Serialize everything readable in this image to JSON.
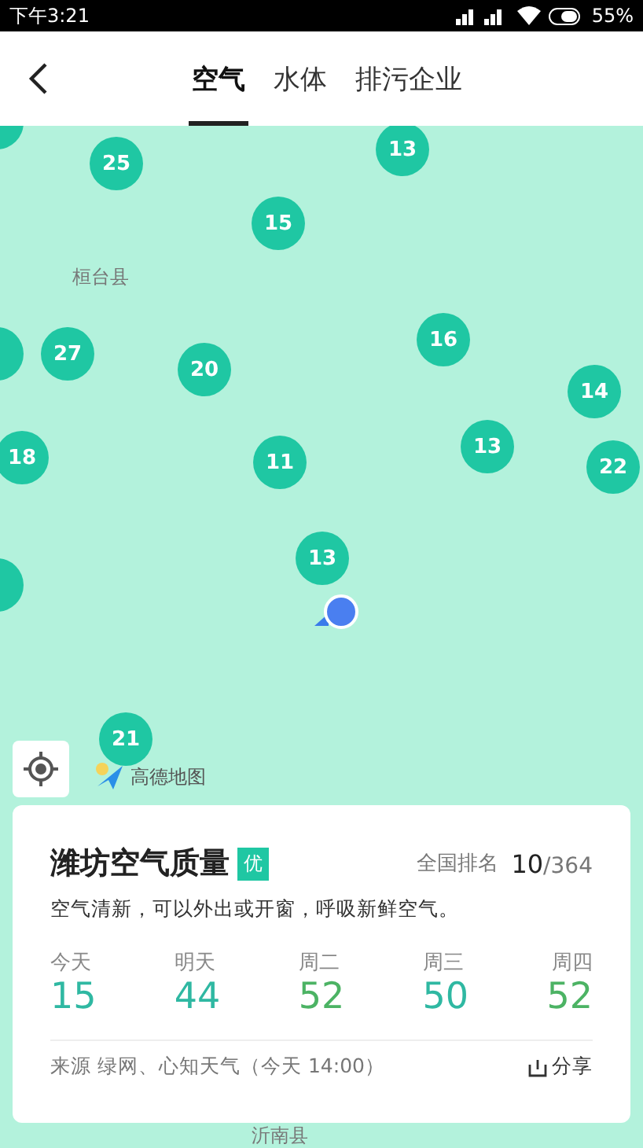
{
  "status_bar": {
    "time": "下午3:21",
    "battery": "55%"
  },
  "header": {
    "tabs": [
      {
        "label": "空气",
        "selected": true
      },
      {
        "label": "水体",
        "selected": false
      },
      {
        "label": "排污企业",
        "selected": false
      }
    ]
  },
  "map": {
    "labels": [
      "桓台县",
      "沂南县"
    ],
    "logo": "高德地图",
    "markers": [
      "25",
      "13",
      "15",
      "27",
      "20",
      "16",
      "14",
      "18",
      "11",
      "13",
      "22",
      "13",
      "21"
    ]
  },
  "card": {
    "city_title": "潍坊空气质量",
    "grade": "优",
    "rank_label": "全国排名",
    "rank": "10",
    "rank_total": "/364",
    "advice": "空气清新，可以外出或开窗，呼吸新鲜空气。",
    "forecast": [
      {
        "day": "今天",
        "aqi": "15",
        "color": "#2fb8a2"
      },
      {
        "day": "明天",
        "aqi": "44",
        "color": "#2fb8a2"
      },
      {
        "day": "周二",
        "aqi": "52",
        "color": "#4cb364"
      },
      {
        "day": "周三",
        "aqi": "50",
        "color": "#2fb8a2"
      },
      {
        "day": "周四",
        "aqi": "52",
        "color": "#4cb364"
      }
    ],
    "source": "来源 绿网、心知天气（今天 14:00）",
    "share": "分享"
  }
}
